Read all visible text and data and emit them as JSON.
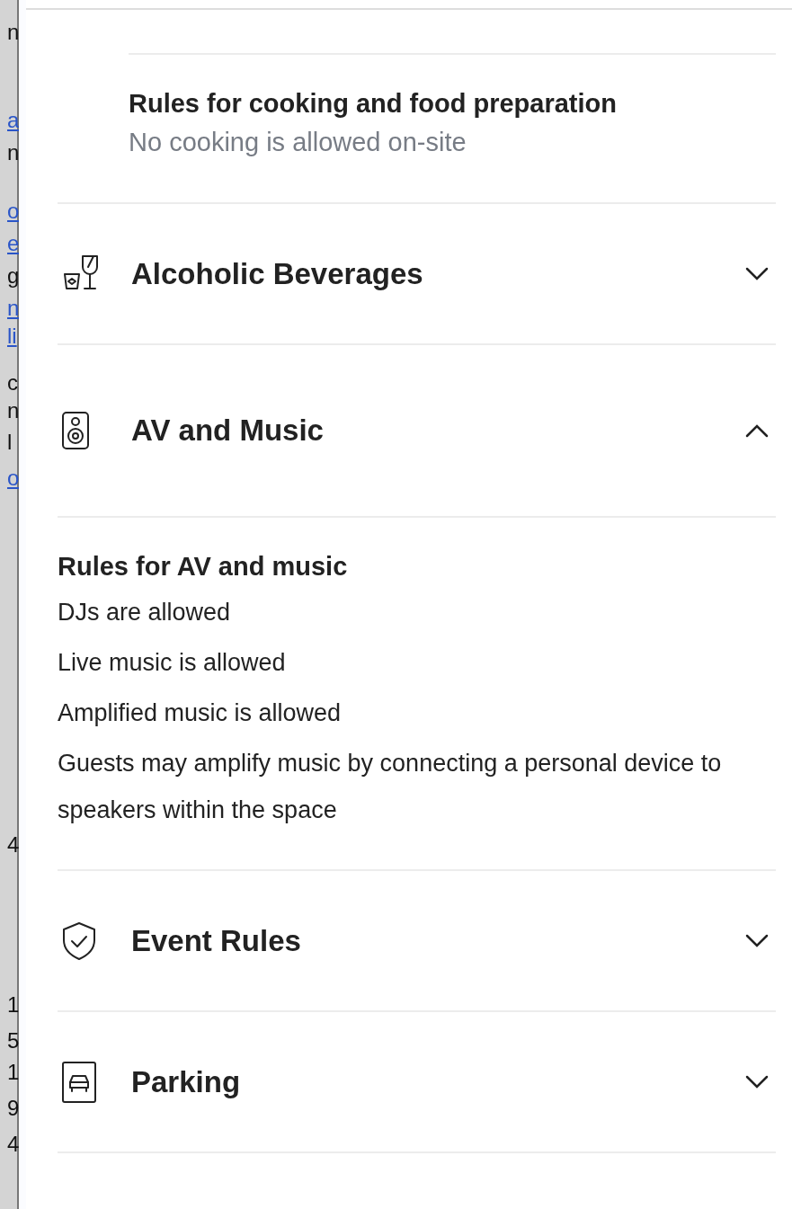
{
  "backdrop_fragments": [
    {
      "text": "n",
      "link": false
    },
    {
      "text": "a",
      "link": true
    },
    {
      "text": "n",
      "link": false
    },
    {
      "text": "o",
      "link": true
    },
    {
      "text": "e",
      "link": true
    },
    {
      "text": "g",
      "link": false
    },
    {
      "text": "n",
      "link": true
    },
    {
      "text": "li",
      "link": true
    },
    {
      "text": "c",
      "link": false
    },
    {
      "text": "n",
      "link": false
    },
    {
      "text": "l",
      "link": false
    },
    {
      "text": "o",
      "link": true
    },
    {
      "text": "4",
      "link": false
    },
    {
      "text": "1",
      "link": false
    },
    {
      "text": "5",
      "link": false
    },
    {
      "text": "1",
      "link": false
    },
    {
      "text": "9",
      "link": false
    },
    {
      "text": "4",
      "link": false
    }
  ],
  "subsection": {
    "title": "Rules for cooking and food preparation",
    "value": "No cooking is allowed on-site"
  },
  "sections": [
    {
      "kind": "drinks",
      "title": "Alcoholic Beverages",
      "expanded": false
    },
    {
      "kind": "speaker",
      "title": "AV and Music",
      "expanded": true,
      "content": {
        "heading": "Rules for AV and music",
        "lines": [
          "DJs are allowed",
          "Live music is allowed",
          "Amplified music is allowed",
          "Guests may amplify music by connecting a personal device to speakers within the space"
        ]
      }
    },
    {
      "kind": "shield",
      "title": "Event Rules",
      "expanded": false
    },
    {
      "kind": "car",
      "title": "Parking",
      "expanded": false
    }
  ]
}
